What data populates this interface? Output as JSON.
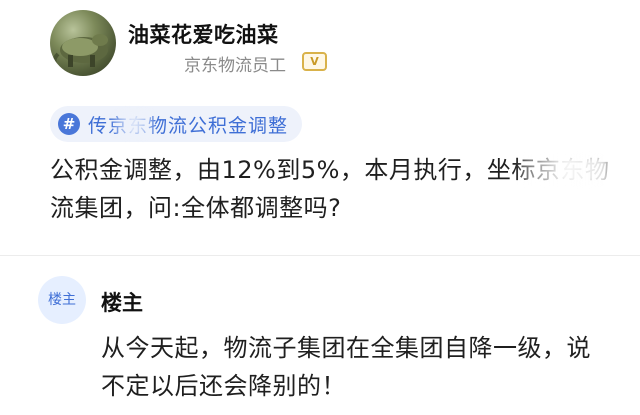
{
  "post": {
    "author": {
      "name": "油菜花爱吃油菜",
      "title": "京东物流员工",
      "badge": "V"
    },
    "topic": {
      "icon": "#",
      "text": "传京东物流公积金调整"
    },
    "body": "公积金调整，由12%到5%，本月执行，坐标京东物流集团，问:全体都调整吗?"
  },
  "reply": {
    "avatar_label": "楼主",
    "author": "楼主",
    "body": "从今天起，物流子集团在全集团自降一级，说不定以后还会降别的！"
  },
  "colors": {
    "accent": "#3f6fd6",
    "tag_bg": "#eef2fb",
    "badge": "#d9b24a",
    "muted": "#8a8a8a"
  },
  "icons": {
    "topic": "hash-icon",
    "verified": "verified-badge-icon"
  }
}
